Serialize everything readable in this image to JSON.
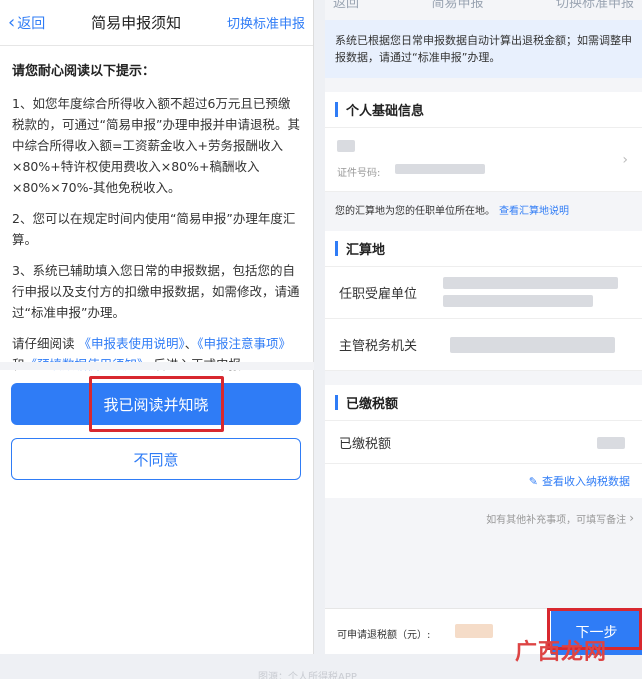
{
  "left": {
    "nav": {
      "back": "返回",
      "title": "简易申报须知",
      "switch": "切换标准申报"
    },
    "heading": "请您耐心阅读以下提示：",
    "p1": "1、如您年度综合所得收入额不超过6万元且已预缴税款的，可通过“简易申报”办理申报并申请退税。其中综合所得收入额=工资薪金收入+劳务报酬收入×80%+特许权使用费收入×80%+稿酬收入×80%×70%-其他免税收入。",
    "p2": "2、您可以在规定时间内使用“简易申报”办理年度汇算。",
    "p3": "3、系统已辅助填入您日常的申报数据，包括您的自行申报以及支付方的扣缴申报数据，如需修改，请通过“标准申报”办理。",
    "p4": {
      "prefix": "请仔细阅读 ",
      "link1": "《申报表使用说明》",
      "sep1": "、",
      "link2": "《申报注意事项》",
      "sep2": "和",
      "link3": "《预填数据使用须知》",
      "suffix": " 后进入正式申报。"
    },
    "btn_agree": "我已阅读并知晓",
    "btn_disagree": "不同意"
  },
  "right": {
    "nav": {
      "back": "返回",
      "title": "简易申报",
      "switch": "切换标准申报"
    },
    "banner": "系统已根据您日常申报数据自动计算出退税金额；如需调整申报数据，请通过“标准申报”办理。",
    "sec_basic": "个人基础信息",
    "id_label": "证件号码:",
    "note": "您的汇算地为您的任职单位所在地。",
    "note_link": "查看汇算地说明",
    "sec_region": "汇算地",
    "employer": "任职受雇单位",
    "tax_office": "主管税务机关",
    "sec_paid": "已缴税额",
    "paid": "已缴税额",
    "view_income": "查看收入纳税数据",
    "extra": "如有其他补充事项，可填写备注",
    "refund_label": "可申请退税额（元）:",
    "next": "下一步"
  },
  "watermark": "广西龙网",
  "caption": "图源：个人所得税APP"
}
